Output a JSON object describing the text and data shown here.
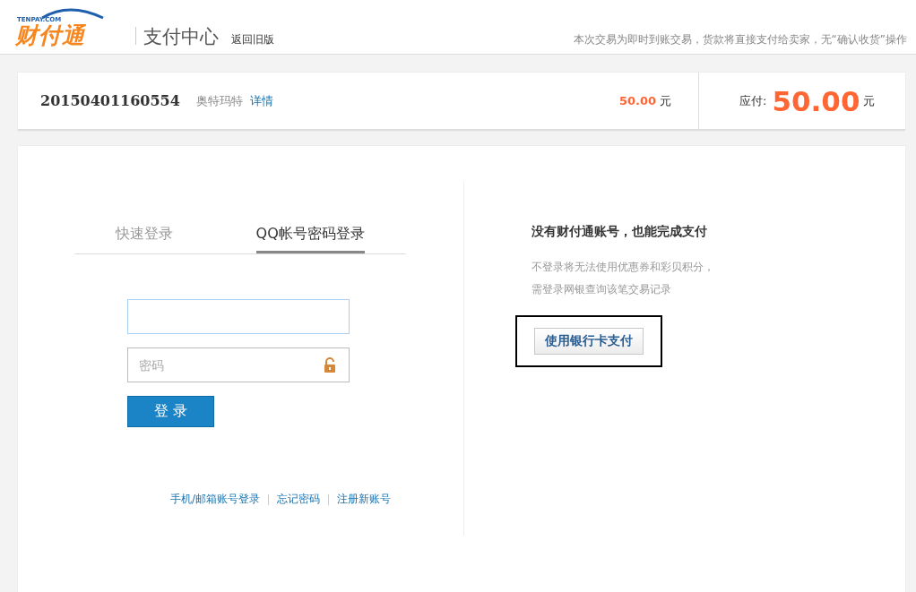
{
  "header": {
    "logo_domain": "TENPAY.COM",
    "logo_text": "财付通",
    "title": "支付中心",
    "back_link": "返回旧版",
    "notice": "本次交易为即时到账交易，货款将直接支付给卖家，无“确认收货”操作"
  },
  "order": {
    "number": "20150401160554",
    "seller": "奥特玛特",
    "details_link": "详情",
    "amount": "50.00",
    "amount_unit": "元",
    "due_label": "应付:",
    "due_amount": "50.00",
    "due_unit": "元"
  },
  "login": {
    "tabs": [
      {
        "label": "快速登录",
        "selected": false
      },
      {
        "label": "QQ帐号密码登录",
        "selected": true
      }
    ],
    "password_field": {
      "placeholder": "密码"
    },
    "login_button": "登 录",
    "links": [
      "手机/邮箱账号登录",
      "忘记密码",
      "注册新账号"
    ]
  },
  "guest": {
    "heading": "没有财付通账号，也能完成支付",
    "notes": [
      "不登录将无法使用优惠券和彩贝积分，",
      "需登录网银查询该笔交易记录"
    ],
    "pay_button": "使用银行卡支付"
  }
}
